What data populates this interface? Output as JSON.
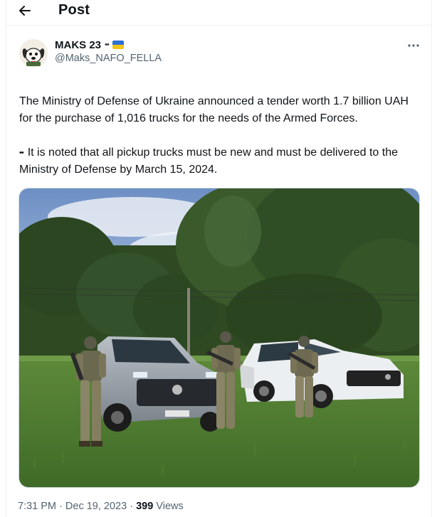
{
  "header": {
    "title": "Post",
    "back_icon": "arrow-left-icon"
  },
  "author": {
    "display_name": "MAKS 23",
    "name_emoji": "••",
    "handle": "@Maks_NAFO_FELLA",
    "flag_icon": "ukraine-flag-icon",
    "avatar_icon": "dog-avatar-icon"
  },
  "more_icon": "more-options-icon",
  "post": {
    "paragraph1": "The Ministry of Defense of Ukraine announced a tender worth 1.7 billion UAH for the purchase of 1,016 trucks for the needs of the Armed Forces.",
    "paragraph2": "It is noted that all pickup trucks must be new and must be delivered to the Ministry of Defense by March 15, 2024.",
    "eyes_emoji": "••"
  },
  "media": {
    "plate_text": ""
  },
  "meta": {
    "time": "7:31 PM",
    "separator": "·",
    "date": "Dec 19, 2023",
    "views_count": "399",
    "views_label": "Views"
  },
  "colors": {
    "text": "#0f1419",
    "secondary": "#536471",
    "border": "#eff3f4",
    "flag_blue": "#2b6fd6",
    "flag_yellow": "#f5c518"
  }
}
